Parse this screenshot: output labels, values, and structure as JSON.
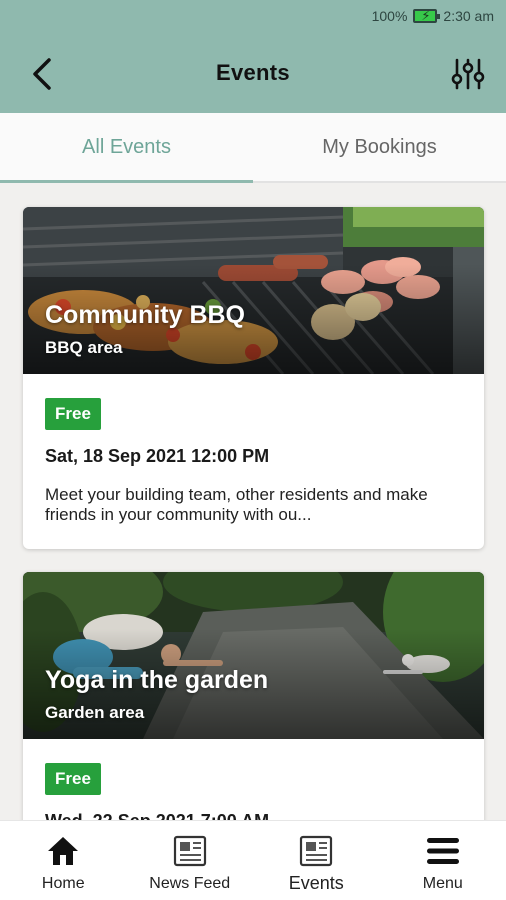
{
  "status_bar": {
    "battery": "100%",
    "time": "2:30 am"
  },
  "header": {
    "title": "Events",
    "back_icon": "chevron-left-icon",
    "filter_icon": "sliders-icon"
  },
  "tabs": [
    {
      "label": "All Events",
      "active": true
    },
    {
      "label": "My Bookings",
      "active": false
    }
  ],
  "events": [
    {
      "title": "Community BBQ",
      "location": "BBQ area",
      "price": "Free",
      "date": "Sat, 18 Sep 2021 12:00 PM",
      "description": "Meet your building team, other residents and make friends in your community with ou..."
    },
    {
      "title": "Yoga in the garden",
      "location": "Garden area",
      "price": "Free",
      "date": "Wed, 22 Sep 2021 7:00 AM",
      "description": ""
    }
  ],
  "bottom_nav": [
    {
      "label": "Home",
      "icon": "home-icon"
    },
    {
      "label": "News Feed",
      "icon": "newspaper-icon"
    },
    {
      "label": "Events",
      "icon": "events-icon",
      "active": true
    },
    {
      "label": "Menu",
      "icon": "menu-icon"
    }
  ],
  "colors": {
    "header": "#8fb9ae",
    "accent": "#6ea598",
    "badge": "#27a03c"
  }
}
